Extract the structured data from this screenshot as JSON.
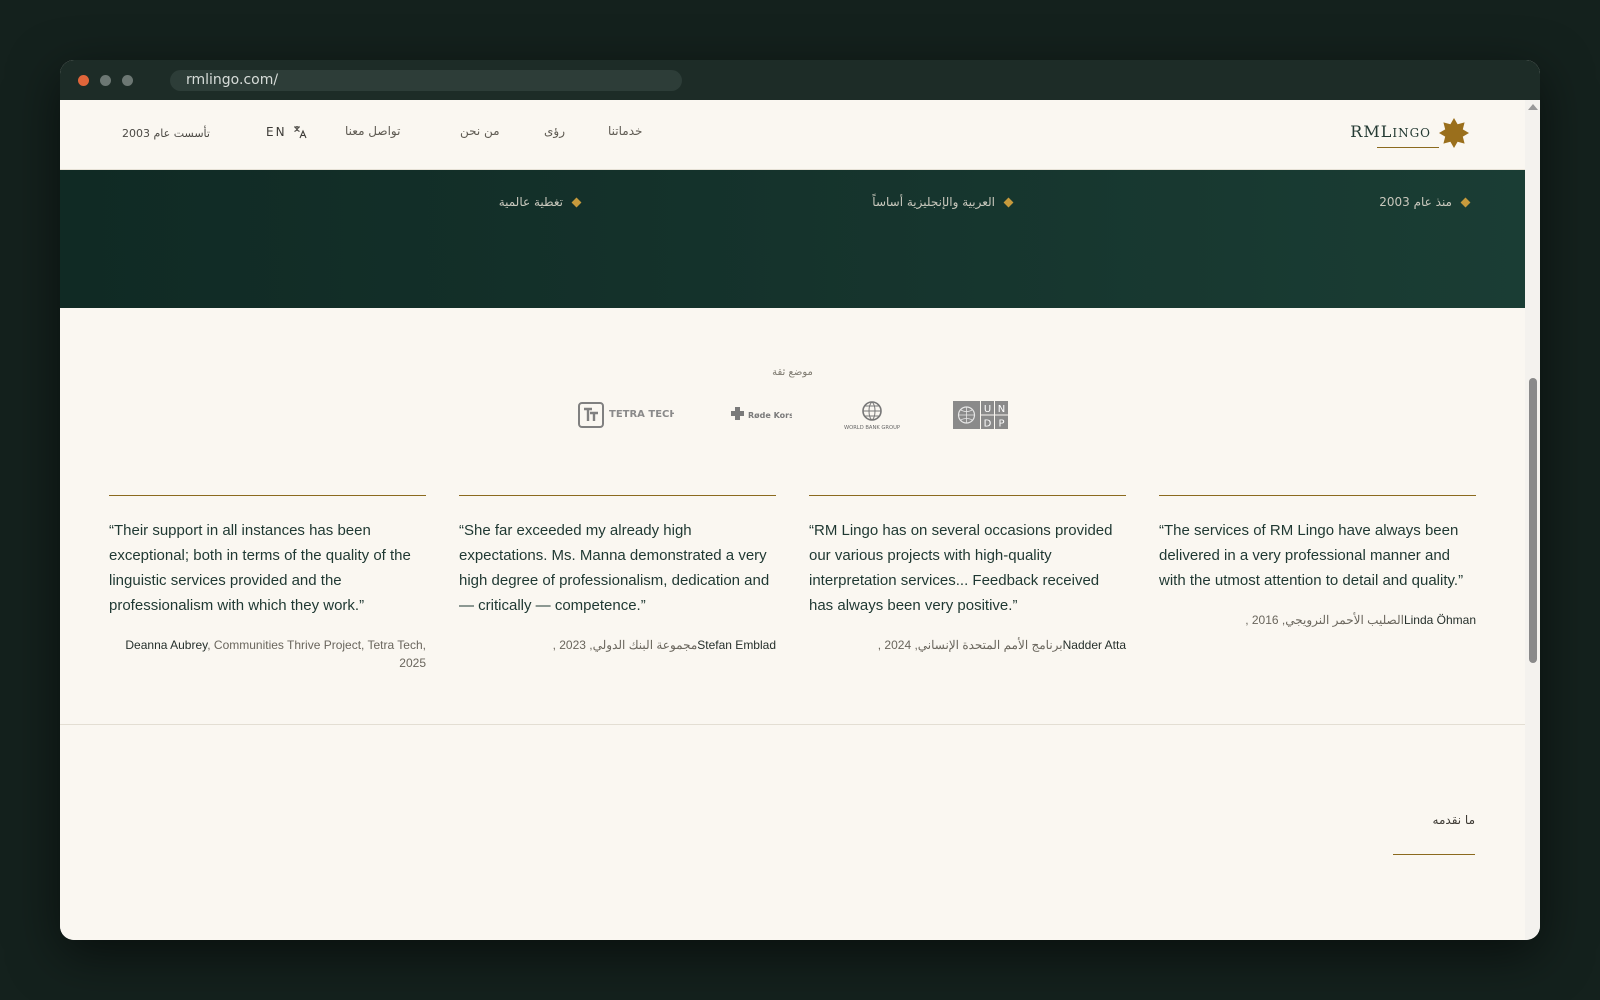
{
  "browser": {
    "url": "rmlingo.com/"
  },
  "header": {
    "logo_main": "RML",
    "logo_small": "INGO",
    "nav": [
      "خدماتنا",
      "رؤى",
      "من نحن",
      "تواصل معنا"
    ],
    "language": "EN",
    "founded": "تأسست عام 2003"
  },
  "banner": {
    "features": [
      "منذ عام 2003",
      "العربية والإنجليزية أساساً",
      "تغطية عالمية"
    ]
  },
  "trust": {
    "label": "موضع ثقة",
    "logos": {
      "tetra": "TETRA TECH",
      "rodekors": "Røde Kors",
      "worldbank": "WORLD BANK GROUP"
    }
  },
  "testimonials": [
    {
      "quote": "“Their support in all instances has been exceptional; both in terms of the quality of the linguistic services provided and the professionalism with which they work.”",
      "name": "Deanna Aubrey",
      "org": ", Communities Thrive Project, Tetra Tech, 2025"
    },
    {
      "quote": "“She far exceeded my already high expectations. Ms. Manna demonstrated a very high degree of professionalism, dedication and — critically — competence.”",
      "name": "Stefan Emblad",
      "org": ", مجموعة البنك الدولي, 2023"
    },
    {
      "quote": "“RM Lingo has on several occasions provided our various projects with high-quality interpretation services... Feedback received has always been very positive.”",
      "name": "Nadder Atta",
      "org": ", برنامج الأمم المتحدة الإنساني, 2024"
    },
    {
      "quote": "“The services of RM Lingo have always been delivered in a very professional manner and with the utmost attention to detail and quality.”",
      "name": "Linda Öhman",
      "org": ", الصليب الأحمر النرويجي, 2016"
    }
  ],
  "section": {
    "offer_title": "ما نقدمه"
  }
}
